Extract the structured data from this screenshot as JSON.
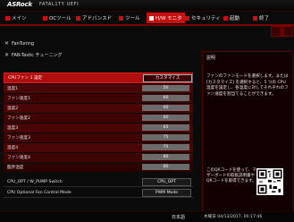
{
  "brand": {
    "name": "ASRock",
    "line": "FATAL1TY UEFI"
  },
  "tabs": [
    {
      "label": "メイン",
      "active": false
    },
    {
      "label": "OCツール",
      "active": false
    },
    {
      "label": "アドバンスド",
      "active": false
    },
    {
      "label": "ツール",
      "active": false
    },
    {
      "label": "H/W モニタ",
      "active": true
    },
    {
      "label": "セキュリティ",
      "active": false
    },
    {
      "label": "起動",
      "active": false
    },
    {
      "label": "終了",
      "active": false
    }
  ],
  "menu": [
    {
      "label": "FanTuning",
      "icon": "fan-icon"
    },
    {
      "label": "FAN-Tastic チューニング",
      "icon": "fan-icon"
    }
  ],
  "fan": {
    "header_label": "CPUファン 1 設定",
    "header_value": "カスタマイズ",
    "rows": [
      {
        "label": "温度1",
        "value": "50"
      },
      {
        "label": "ファン速度1",
        "value": "60"
      },
      {
        "label": "温度2",
        "value": "60"
      },
      {
        "label": "ファン速度2",
        "value": "60"
      },
      {
        "label": "温度3",
        "value": "65"
      },
      {
        "label": "ファン速度3",
        "value": "75"
      },
      {
        "label": "温度4",
        "value": "75"
      },
      {
        "label": "ファン速度4",
        "value": "80"
      },
      {
        "label": "臨界温度",
        "value": "80"
      }
    ]
  },
  "lower": [
    {
      "label": "CPU_OPT / W_PUMP Switch",
      "value": "CPU_OPT"
    },
    {
      "label": "CPU Optional Fan Control Mode",
      "value": "PWM Mode"
    }
  ],
  "description": {
    "title": "説明",
    "body": "ファンのファンモードを選択します。または [カスタマイズ] を選択すると、5 つの CPU 温度を設定し、各温度に対してそれぞれのファン速度を割当てることができます。",
    "qr_text": "このQRコードを使って、マザーボードの取扱説明書やQRコードを取得できます。"
  },
  "footer": {
    "language": "日本語",
    "datetime": "木曜日 04/13/2017, 00:17:46"
  },
  "colors": {
    "accent": "#c81010",
    "background": "#0b0b0b"
  }
}
